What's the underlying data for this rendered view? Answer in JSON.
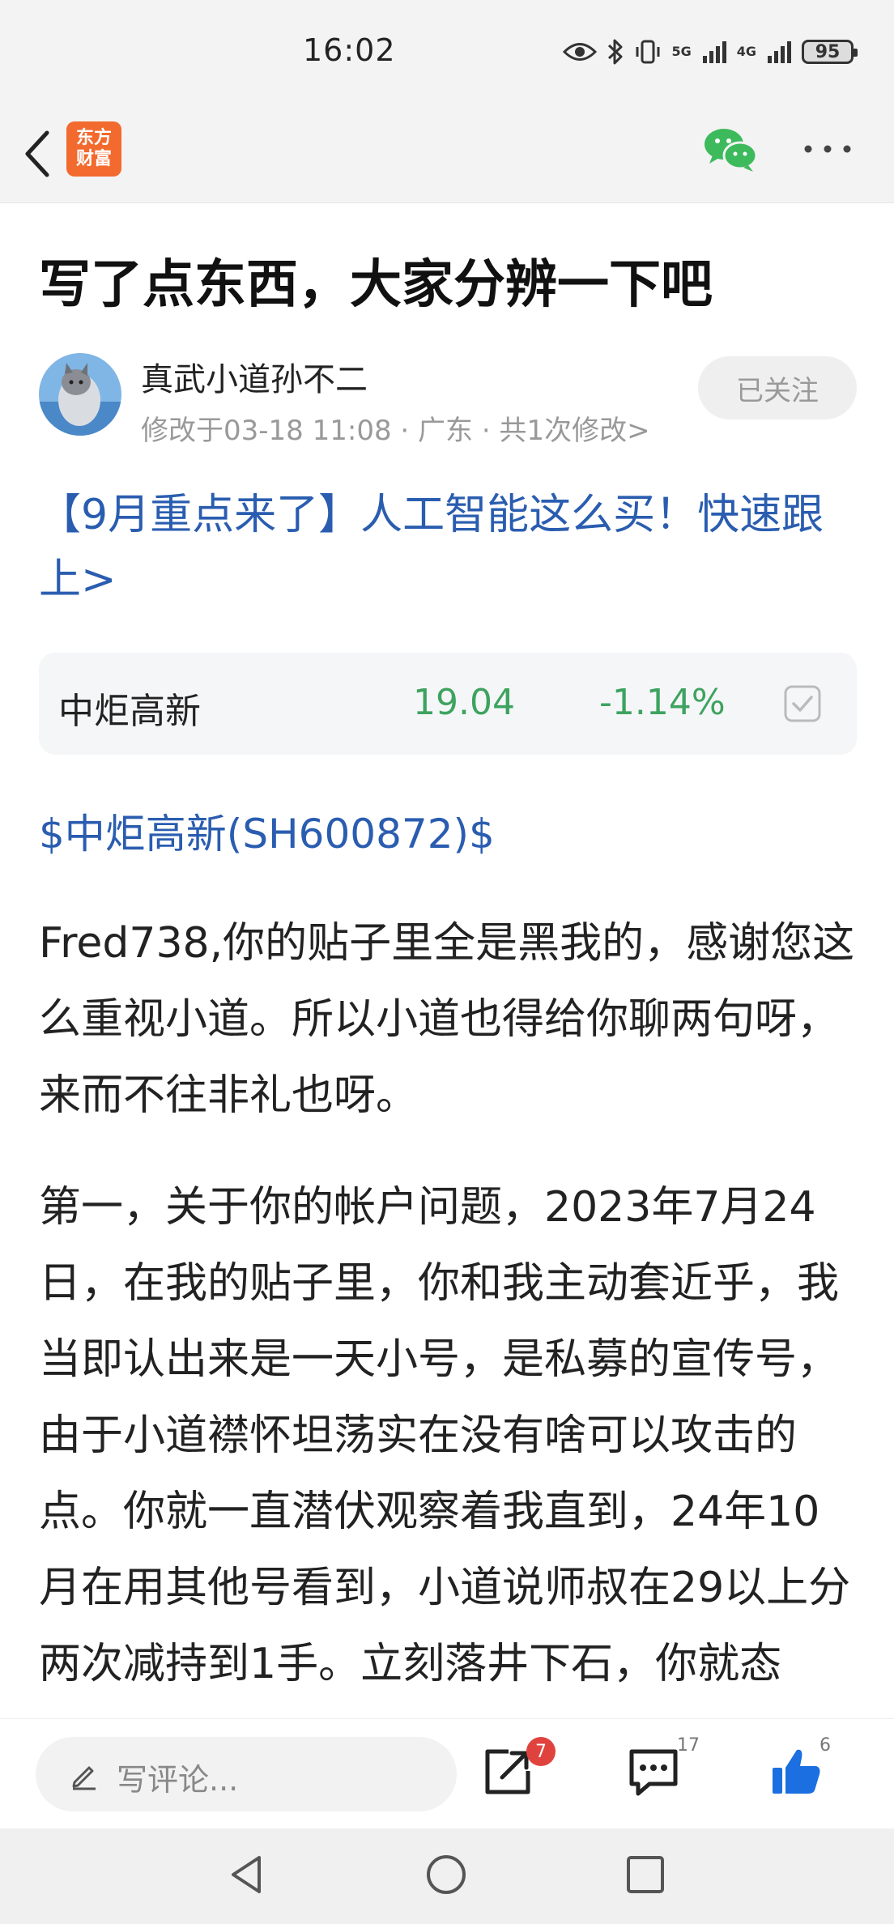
{
  "status_bar": {
    "time": "16:02",
    "net1": "5G",
    "net2": "4G",
    "battery": "95"
  },
  "navbar": {
    "app_logo_line1": "东方",
    "app_logo_line2": "财富"
  },
  "article": {
    "title": "写了点东西，大家分辨一下吧",
    "author_name": "真武小道孙不二",
    "author_meta": "修改于03-18 11:08 · 广东 · 共1次修改>",
    "follow_label": "已关注",
    "promo_link": "【9月重点来了】人工智能这么买！快速跟上>",
    "stock_card": {
      "name": "中炬高新",
      "price": "19.04",
      "change": "-1.14%"
    },
    "stock_tag": "$中炬高新(SH600872)$",
    "paragraphs": [
      "Fred738,你的贴子里全是黑我的，感谢您这么重视小道。所以小道也得给你聊两句呀，来而不往非礼也呀。",
      "第一，关于你的帐户问题，2023年7月24日，在我的贴子里，你和我主动套近乎，我当即认出来是一天小号，是私募的宣传号，由于小道襟怀坦荡实在没有啥可以攻击的点。你就一直潜伏观察着我直到，24年10月在用其他号看到，小道说师叔在29以上分两次减持到1手。立刻落井下石，你就态"
    ]
  },
  "action_bar": {
    "comment_placeholder": "写评论...",
    "share_badge": "7",
    "comments_count": "17",
    "likes_count": "6"
  },
  "colors": {
    "link": "#2a5db0",
    "stock_down": "#3da35f",
    "badge": "#e0433e",
    "logo": "#f26a2e",
    "like": "#1b6fe0"
  }
}
